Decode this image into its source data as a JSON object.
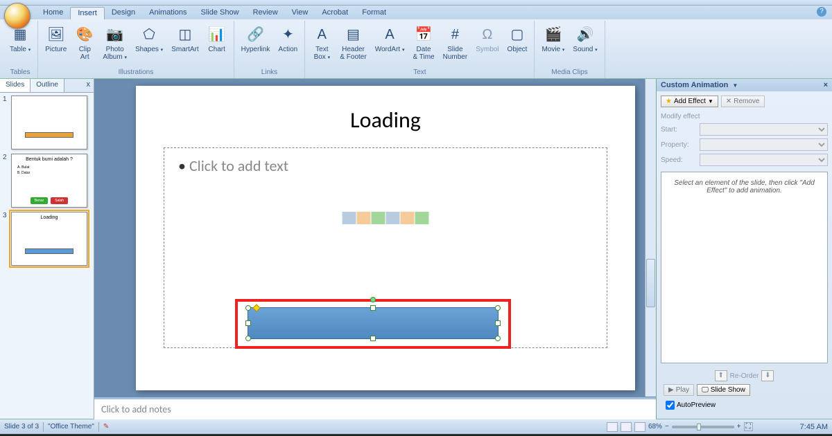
{
  "tabs": [
    "Home",
    "Insert",
    "Design",
    "Animations",
    "Slide Show",
    "Review",
    "View",
    "Acrobat",
    "Format"
  ],
  "active_tab": "Insert",
  "ribbon_groups": [
    {
      "label": "Tables",
      "items": [
        {
          "name": "table",
          "label": "Table",
          "icon": "▦",
          "dd": true
        }
      ]
    },
    {
      "label": "Illustrations",
      "items": [
        {
          "name": "picture",
          "label": "Picture",
          "icon": "🖼"
        },
        {
          "name": "clipart",
          "label": "Clip\nArt",
          "icon": "🎨"
        },
        {
          "name": "photoalbum",
          "label": "Photo\nAlbum",
          "icon": "📷",
          "dd": true
        },
        {
          "name": "shapes",
          "label": "Shapes",
          "icon": "⬠",
          "dd": true
        },
        {
          "name": "smartart",
          "label": "SmartArt",
          "icon": "◫"
        },
        {
          "name": "chart",
          "label": "Chart",
          "icon": "📊"
        }
      ]
    },
    {
      "label": "Links",
      "items": [
        {
          "name": "hyperlink",
          "label": "Hyperlink",
          "icon": "🔗"
        },
        {
          "name": "action",
          "label": "Action",
          "icon": "✦"
        }
      ]
    },
    {
      "label": "Text",
      "items": [
        {
          "name": "textbox",
          "label": "Text\nBox",
          "icon": "A",
          "dd": true
        },
        {
          "name": "headerfooter",
          "label": "Header\n& Footer",
          "icon": "▤"
        },
        {
          "name": "wordart",
          "label": "WordArt",
          "icon": "A",
          "dd": true
        },
        {
          "name": "datetime",
          "label": "Date\n& Time",
          "icon": "📅"
        },
        {
          "name": "slidenumber",
          "label": "Slide\nNumber",
          "icon": "#"
        },
        {
          "name": "symbol",
          "label": "Symbol",
          "icon": "Ω",
          "disabled": true
        },
        {
          "name": "object",
          "label": "Object",
          "icon": "▢"
        }
      ]
    },
    {
      "label": "Media Clips",
      "items": [
        {
          "name": "movie",
          "label": "Movie",
          "icon": "🎬",
          "dd": true
        },
        {
          "name": "sound",
          "label": "Sound",
          "icon": "🔊",
          "dd": true
        }
      ]
    }
  ],
  "panel": {
    "tabs": [
      "Slides",
      "Outline"
    ],
    "active": "Slides",
    "close": "x"
  },
  "thumbs": [
    {
      "n": "1",
      "title": "",
      "bar": true
    },
    {
      "n": "2",
      "title": "Bentuk bumi adalah ?",
      "opts": [
        "A. Bulat",
        "B. Datar"
      ],
      "btns": [
        "Benar",
        "Salah"
      ]
    },
    {
      "n": "3",
      "title": "Loading",
      "bar": true,
      "selected": true
    }
  ],
  "slide": {
    "title": "Loading",
    "placeholder": "Click to add text"
  },
  "notes_placeholder": "Click to add notes",
  "taskpane": {
    "title": "Custom Animation",
    "add_effect": "Add Effect",
    "remove": "Remove",
    "modify": "Modify effect",
    "start": "Start:",
    "property": "Property:",
    "speed": "Speed:",
    "hint": "Select an element of the slide, then click \"Add Effect\" to add animation.",
    "reorder": "Re-Order",
    "play": "Play",
    "slideshow": "Slide Show",
    "autopreview": "AutoPreview"
  },
  "status": {
    "slide": "Slide 3 of 3",
    "theme": "\"Office Theme\"",
    "zoom": "68%",
    "time": "7:45 AM"
  }
}
